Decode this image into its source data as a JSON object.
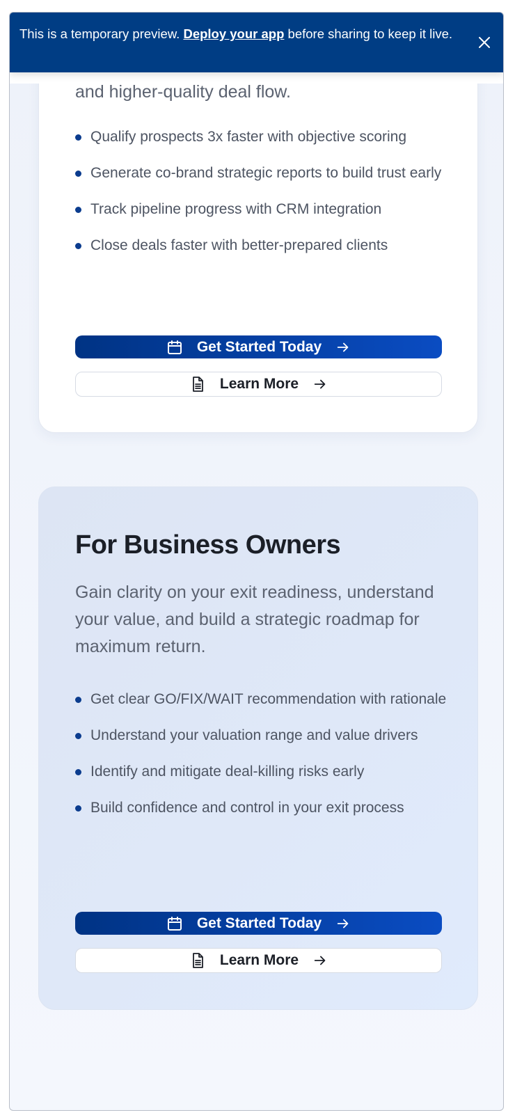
{
  "banner": {
    "text_before": "This is a temporary preview. ",
    "link_text": "Deploy your app",
    "text_after": " before sharing to keep it live."
  },
  "card_investors": {
    "description_tail": "and higher-quality deal flow.",
    "bullets": [
      "Qualify prospects 3x faster with objective scoring",
      "Generate co-brand strategic reports to build trust early",
      "Track pipeline progress with CRM integration",
      "Close deals faster with better-prepared clients"
    ],
    "primary_button": "Get Started Today",
    "secondary_button": "Learn More"
  },
  "card_owners": {
    "title": "For Business Owners",
    "description": "Gain clarity on your exit readiness, understand your value, and build a strategic roadmap for maximum return.",
    "bullets": [
      "Get clear GO/FIX/WAIT recommendation with rationale",
      "Understand your valuation range and value drivers",
      "Identify and mitigate deal-killing risks early",
      "Build confidence and control in your exit process"
    ],
    "primary_button": "Get Started Today",
    "secondary_button": "Learn More"
  },
  "colors": {
    "banner_bg": "#003d84",
    "primary_gradient_start": "#003384",
    "primary_gradient_end": "#0a4cc2",
    "bullet_dot": "#0b3c8e"
  },
  "icons": {
    "calendar": "calendar-icon",
    "document": "document-icon",
    "arrow": "arrow-right-icon",
    "close": "close-icon"
  }
}
